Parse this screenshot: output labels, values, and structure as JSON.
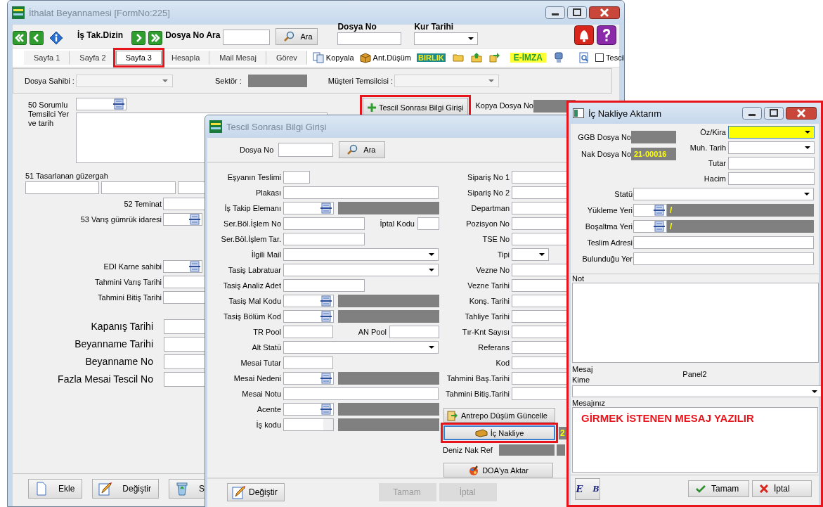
{
  "main_window": {
    "title": "İthalat Beyannamesi [FormNo:225]",
    "toolbar": {
      "is_tak_label": "İş Tak.Dizin",
      "search_label": "Dosya No Ara",
      "search_button": "Ara",
      "dosya_no_label": "Dosya No",
      "kur_tarihi_label": "Kur Tarihi"
    },
    "tabs": [
      {
        "label": "Sayfa 1",
        "selected": false,
        "highlighted": false
      },
      {
        "label": "Sayfa 2",
        "selected": false,
        "highlighted": false
      },
      {
        "label": "Sayfa 3",
        "selected": true,
        "highlighted": true
      },
      {
        "label": "Hesapla",
        "selected": false,
        "highlighted": false
      },
      {
        "label": "Mail Mesaj",
        "selected": false,
        "highlighted": false
      },
      {
        "label": "Görev",
        "selected": false,
        "highlighted": false
      }
    ],
    "tools": [
      {
        "kind": "copy",
        "label": "Kopyala"
      },
      {
        "kind": "box",
        "label": "Ant.Düşüm"
      },
      {
        "kind": "badge",
        "label": "BIRLIK"
      },
      {
        "kind": "folder"
      },
      {
        "kind": "upload"
      },
      {
        "kind": "move"
      },
      {
        "kind": "stamp",
        "label": "E-İMZA"
      },
      {
        "kind": "device"
      },
      {
        "kind": "divider"
      },
      {
        "kind": "preview"
      },
      {
        "kind": "checkbox",
        "label": "Tescil",
        "checked": false
      }
    ],
    "filter": {
      "dosya_sahibi_label": "Dosya Sahibi :",
      "sektor_label": "Sektör :",
      "musteri_label": "Müşteri Temsilcisi :"
    },
    "sorumlu_label": "50 Sorumlu Temsilci Yer ve tarih",
    "guzergah_label": "51 Tasarlanan güzergah",
    "row_groups": [
      {
        "kind": "normal",
        "rows": [
          {
            "label": "52 Teminat",
            "kind": "text"
          },
          {
            "label": "53 Varış gümrük idaresi",
            "kind": "lookup"
          }
        ]
      },
      {
        "kind": "normal",
        "rows": [
          {
            "label": "EDI Karne sahibi",
            "kind": "lookup"
          },
          {
            "label": "Tahmini Varış Tarihi",
            "kind": "text"
          },
          {
            "label": "Tahmini Bitiş Tarihi",
            "kind": "text"
          }
        ]
      },
      {
        "kind": "large",
        "rows": [
          {
            "label": "Kapanış Tarihi",
            "kind": "text"
          },
          {
            "label": "Beyanname Tarihi",
            "kind": "text"
          },
          {
            "label": "Beyanname No",
            "kind": "text"
          },
          {
            "label": "Fazla Mesai Tescil No",
            "kind": "text"
          }
        ]
      }
    ],
    "tescil_button": {
      "label": "Tescil Sonrası Bilgi Girişi",
      "highlighted": true
    },
    "kopya_label": "Kopya Dosya No",
    "buttons": [
      {
        "kind": "new",
        "label": "Ekle"
      },
      {
        "kind": "edit",
        "label": "Değiştir"
      },
      {
        "kind": "trash",
        "label": "S"
      }
    ]
  },
  "detail_window": {
    "title": "Tescil Sonrası Bilgi Girişi",
    "dosya_no_label": "Dosya No",
    "search_button": "Ara",
    "left_rows": [
      {
        "label": "Eşyanın Teslimi",
        "kind": "short"
      },
      {
        "label": "Plakası",
        "kind": "wide"
      },
      {
        "label": "İş Takip Elemanı",
        "kind": "lookup"
      },
      {
        "label": "Ser.Böl.İşlem No",
        "kind": "text",
        "extra": {
          "label": "İptal Kodu",
          "kind": "tiny"
        }
      },
      {
        "label": "Ser.Böl.İşlem Tar.",
        "kind": "text"
      },
      {
        "label": "İlgili Mail",
        "kind": "combo"
      },
      {
        "label": "Tasiş Labratuar",
        "kind": "combo"
      },
      {
        "label": "Tasiş Analiz Adet",
        "kind": "text"
      },
      {
        "label": "Tasiş Mal Kodu",
        "kind": "lookup"
      },
      {
        "label": "Tasiş Bölüm Kod",
        "kind": "lookup"
      },
      {
        "label": "TR Pool",
        "kind": "pool",
        "extra": {
          "label": "AN Pool",
          "kind": "pool"
        }
      },
      {
        "label": "Alt Statü",
        "kind": "combo"
      },
      {
        "label": "Mesai Tutar",
        "kind": "pool"
      },
      {
        "label": "Mesai Nedeni",
        "kind": "lookup"
      },
      {
        "label": "Mesai Notu",
        "kind": "wide"
      },
      {
        "label": "Acente",
        "kind": "lookup"
      },
      {
        "label": "İş kodu",
        "kind": "locked"
      }
    ],
    "right_rows": [
      {
        "label": "Sipariş No 1",
        "kind": "text"
      },
      {
        "label": "Sipariş No 2",
        "kind": "text"
      },
      {
        "label": "Departman",
        "kind": "text"
      },
      {
        "label": "Pozisyon No",
        "kind": "text"
      },
      {
        "label": "TSE No",
        "kind": "text"
      },
      {
        "label": "Tipi",
        "kind": "select"
      },
      {
        "label": "Vezne No",
        "kind": "text"
      },
      {
        "label": "Vezne Tarihi",
        "kind": "text"
      },
      {
        "label": "Konş. Tarihi",
        "kind": "text"
      },
      {
        "label": "Tahliye Tarihi",
        "kind": "text"
      },
      {
        "label": "Tır-Knt Sayısı",
        "kind": "text"
      },
      {
        "label": "Referans",
        "kind": "text"
      },
      {
        "label": "Kod",
        "kind": "text"
      },
      {
        "label": "Tahmini Baş.Tarihi",
        "kind": "text"
      },
      {
        "label": "Tahmini Bitiş.Tarihi",
        "kind": "text"
      }
    ],
    "antrepo_button": {
      "label": "Antrepo Düşüm Güncelle"
    },
    "nakliye_button": {
      "label": "İç Nakliye",
      "highlighted": true,
      "focused": true
    },
    "nakliye_no_partial": "2",
    "deniz_label": "Deniz Nak Ref",
    "doa_button": {
      "label": "DOA'ya Aktar"
    },
    "buttons": [
      {
        "kind": "edit",
        "label": "Değiştir",
        "disabled": false
      },
      {
        "kind": "plain",
        "label": "Tamam",
        "disabled": true
      },
      {
        "kind": "plain",
        "label": "İptal",
        "disabled": true
      }
    ]
  },
  "transfer_window": {
    "title": "İç Nakliye Aktarım",
    "highlighted": true,
    "ggb_label": "GGB Dosya No",
    "nak_label": "Nak Dosya No",
    "nak_value": "21-00016",
    "right_rows": [
      {
        "label": "Öz/Kira",
        "kind": "combo",
        "required": true
      },
      {
        "label": "Muh. Tarih",
        "kind": "combo",
        "required": false
      },
      {
        "label": "Tutar",
        "kind": "text",
        "required": false
      },
      {
        "label": "Hacim",
        "kind": "text",
        "required": false
      }
    ],
    "rows": [
      {
        "label": "Statü",
        "kind": "combo"
      },
      {
        "label": "Yükleme Yeri",
        "kind": "lookup",
        "value": "/"
      },
      {
        "label": "Boşaltma Yeri",
        "kind": "lookup",
        "value": "/"
      },
      {
        "label": "Teslim Adresi",
        "kind": "text"
      },
      {
        "label": "Bulunduğu Yer",
        "kind": "text"
      }
    ],
    "not_label": "Not",
    "mesaj_label": "Mesaj",
    "kime_label": "Kime",
    "panel_caption": "Panel2",
    "mesajiniz_label": "Mesajınız",
    "message_value": "GİRMEK İSTENEN MESAJ YAZILIR",
    "buttons": [
      {
        "kind": "logo",
        "label": "E$_{B}$"
      },
      {
        "kind": "ok",
        "label": "Tamam"
      },
      {
        "kind": "cancel",
        "label": "İptal"
      }
    ]
  }
}
